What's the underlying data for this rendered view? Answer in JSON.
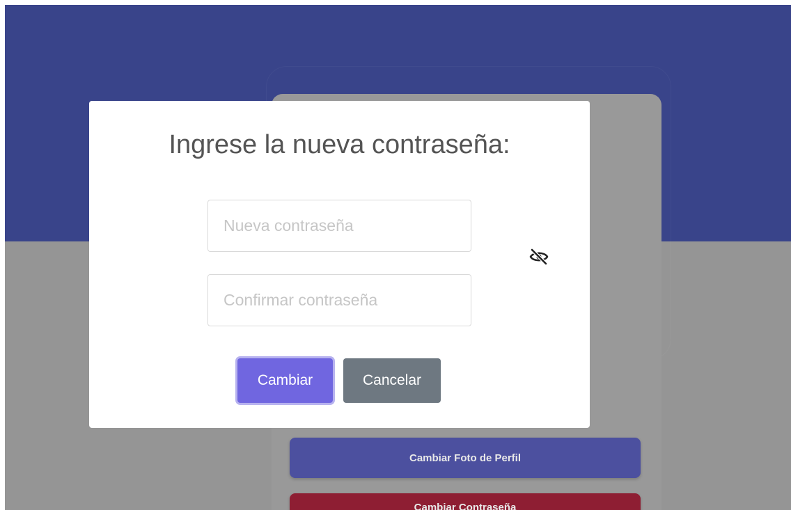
{
  "background": {
    "hero_color": "#39448a",
    "overlay_color": "#959595"
  },
  "profile_card": {
    "change_photo_label": "Cambiar Foto de Perfil",
    "change_password_label": "Cambiar Contraseña"
  },
  "modal": {
    "title": "Ingrese la nueva contraseña:",
    "new_password": {
      "value": "",
      "placeholder": "Nueva contraseña"
    },
    "confirm_password": {
      "value": "",
      "placeholder": "Confirmar contraseña"
    },
    "visibility_toggle_icon": "eye-slash-icon",
    "confirm_label": "Cambiar",
    "cancel_label": "Cancelar"
  },
  "colors": {
    "confirm_button": "#7066e0",
    "cancel_button": "#6e7881",
    "photo_button": "#4c509f",
    "password_button": "#8e1e33"
  }
}
